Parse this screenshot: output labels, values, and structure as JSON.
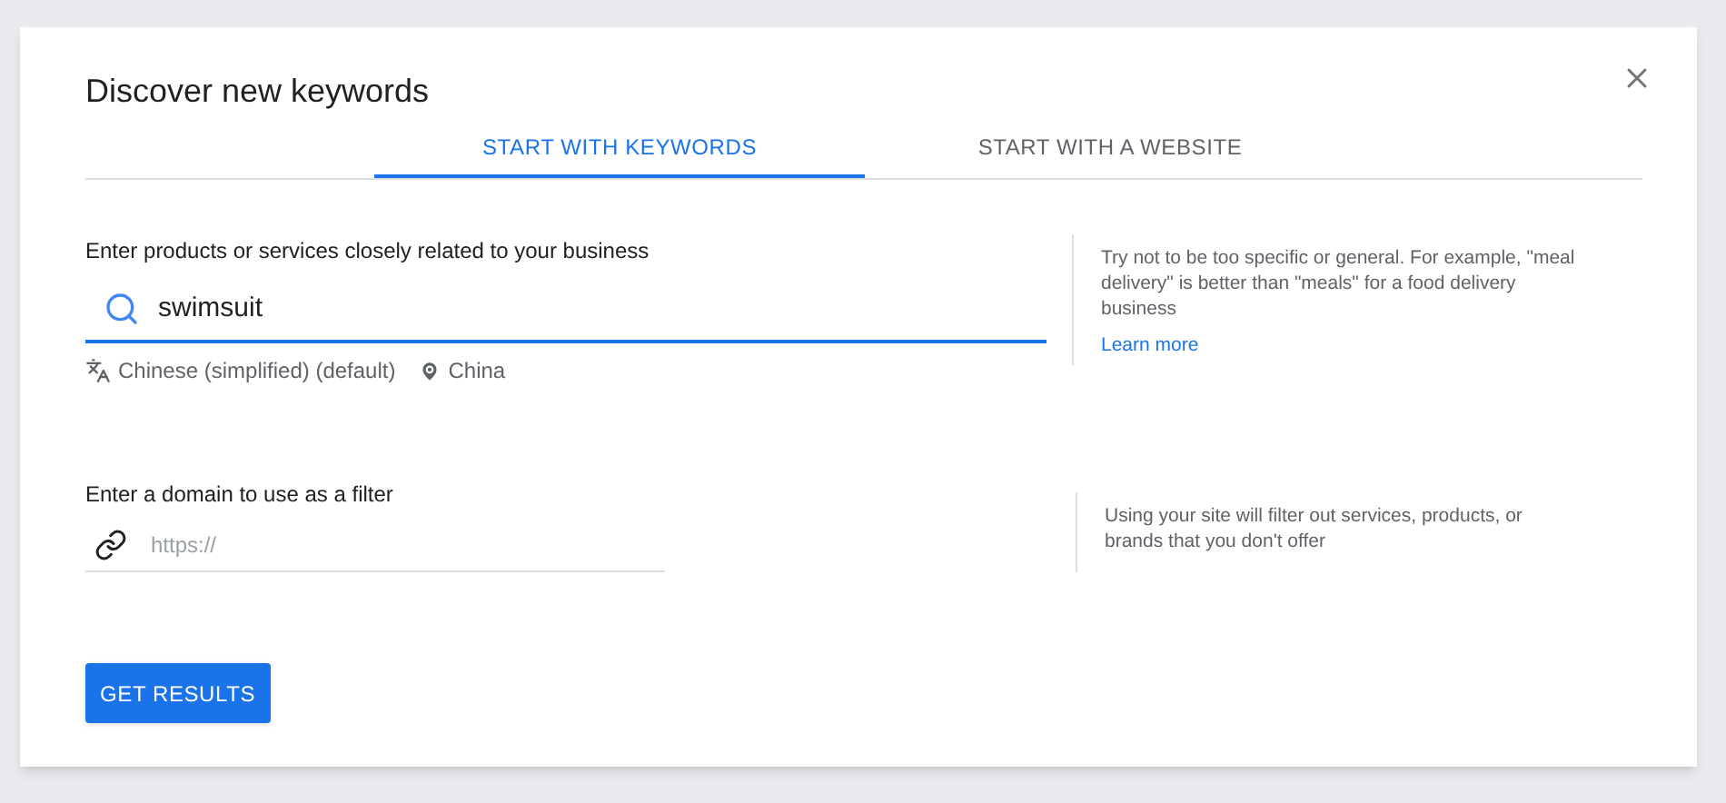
{
  "dialog": {
    "title": "Discover new keywords"
  },
  "tabs": [
    {
      "label": "START WITH KEYWORDS",
      "selected": true
    },
    {
      "label": "START WITH A WEBSITE",
      "selected": false
    }
  ],
  "keywords": {
    "label": "Enter products or services closely related to your business",
    "value": "swimsuit",
    "focused": true,
    "language": "Chinese (simplified) (default)",
    "location": "China",
    "hint": "Try not to be too specific or general. For example, \"meal delivery\" is better than \"meals\" for a food delivery business",
    "link": "Learn more"
  },
  "domain": {
    "label": "Enter a domain to use as a filter",
    "placeholder": "https://",
    "focused": false,
    "hint": "Using your site will filter out services, products, or brands that you don't offer"
  },
  "button": "GET RESULTS"
}
